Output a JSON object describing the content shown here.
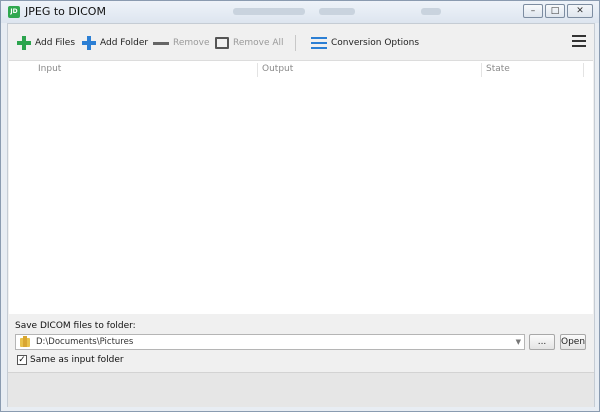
{
  "app": {
    "icon_label": "JD",
    "title": "JPEG to DICOM"
  },
  "window_controls": {
    "minimize": "–",
    "maximize": "□",
    "close": "✕"
  },
  "toolbar": {
    "add_files": "Add Files",
    "add_folder": "Add Folder",
    "remove": "Remove",
    "remove_all": "Remove All",
    "conversion_options": "Conversion Options"
  },
  "table": {
    "columns": [
      "Input",
      "Output",
      "State"
    ]
  },
  "bottom": {
    "save_label": "Save DICOM files to folder:",
    "path_value": "D:\\Documents\\Pictures",
    "browse_label": "...",
    "open_label": "Open",
    "same_as_input": "Same as input folder",
    "same_as_input_checked": true
  },
  "colors": {
    "add_files_icon": "#2ca44e",
    "accent_blue": "#2c7fd4",
    "disabled_text": "#9a9a9a"
  }
}
